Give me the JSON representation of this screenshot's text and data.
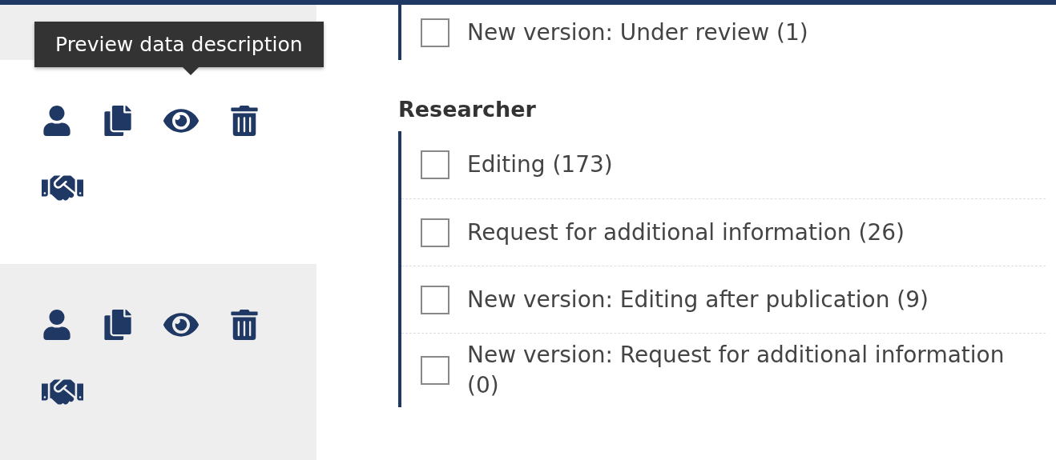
{
  "tooltip": {
    "text": "Preview data description"
  },
  "record_rows": [
    {
      "kind": "blank"
    },
    {
      "kind": "actions"
    },
    {
      "kind": "actions"
    }
  ],
  "filter_groups": [
    {
      "items": [
        {
          "label": "New version: Under review (1)",
          "checked": false
        }
      ]
    },
    {
      "heading": "Researcher",
      "items": [
        {
          "label": "Editing (173)",
          "checked": false
        },
        {
          "label": "Request for additional information (26)",
          "checked": false
        },
        {
          "label": "New version: Editing after publication (9)",
          "checked": false
        },
        {
          "label": "New version: Request for additional information (0)",
          "checked": false
        }
      ]
    }
  ]
}
